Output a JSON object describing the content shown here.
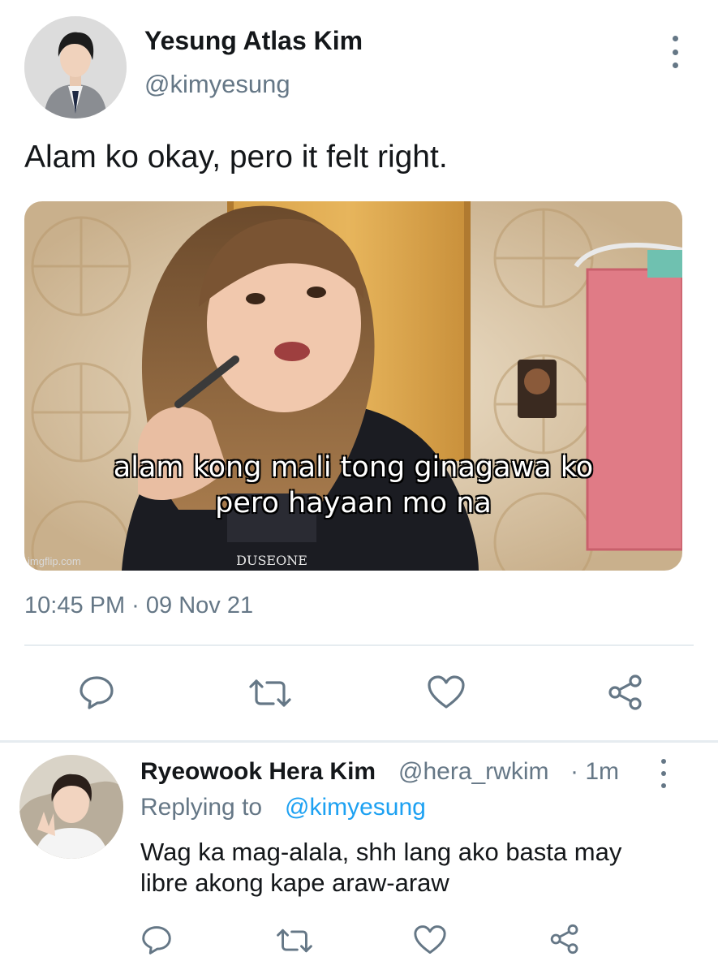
{
  "tweet": {
    "author_name": "Yesung Atlas Kim",
    "author_handle": "@kimyesung",
    "text": "Alam ko okay, pero it felt right.",
    "media": {
      "caption_line1": "alam kong mali tong ginagawa ko",
      "caption_line2": "pero hayaan mo na",
      "watermark": "imgflip.com"
    },
    "timestamp": "10:45 PM · 09 Nov 21",
    "actions": [
      "reply-icon",
      "retweet-icon",
      "like-icon",
      "share-icon"
    ]
  },
  "reply": {
    "author_name": "Ryeowook Hera Kim",
    "author_handle": "@hera_rwkim",
    "time": "· 1m",
    "replying_prefix": "Replying to",
    "replying_to": "@kimyesung",
    "text_line1": "Wag ka mag-alala, shh lang ako basta may",
    "text_line2": "libre akong kape araw-araw",
    "actions": [
      "reply-icon",
      "retweet-icon",
      "like-icon",
      "share-icon"
    ]
  },
  "colors": {
    "text": "#14171a",
    "secondary": "#657786",
    "link": "#1da1f2",
    "divider": "#e6ecf0"
  }
}
